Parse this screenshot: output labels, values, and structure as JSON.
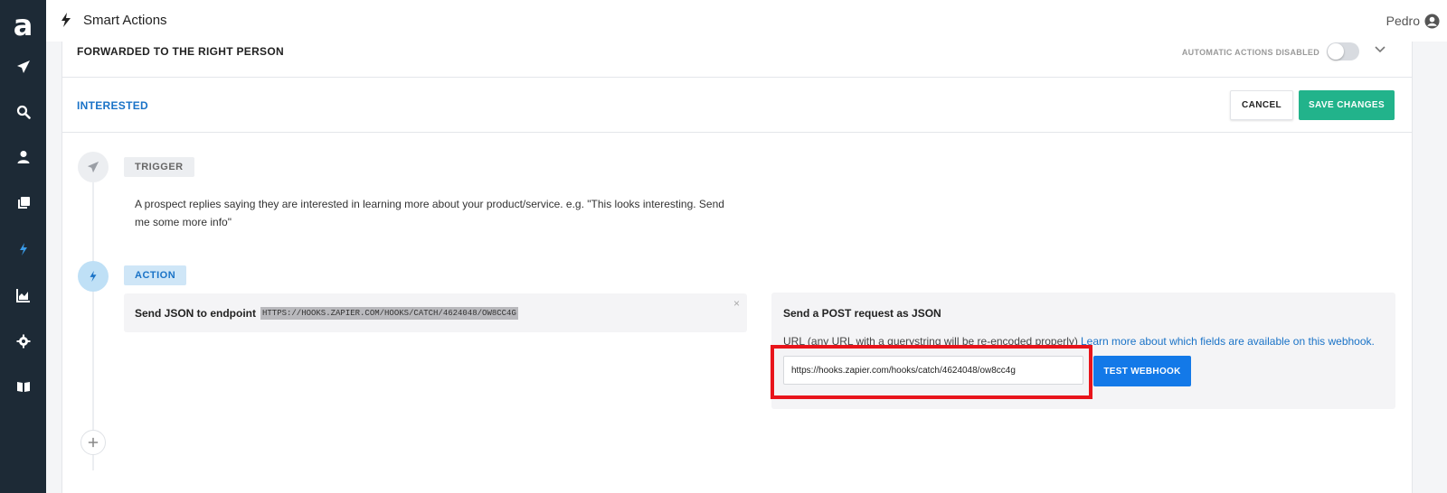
{
  "app": {
    "logo_letter": "a",
    "title": "Smart Actions",
    "user_name": "Pedro"
  },
  "sidebar": {
    "items": [
      {
        "icon": "paper-plane-icon"
      },
      {
        "icon": "search-icon"
      },
      {
        "icon": "user-icon"
      },
      {
        "icon": "copy-icon"
      },
      {
        "icon": "bolt-icon",
        "active": true
      },
      {
        "icon": "chart-icon"
      },
      {
        "icon": "gear-icon"
      },
      {
        "icon": "book-icon"
      }
    ]
  },
  "forwarded": {
    "title": "FORWARDED TO THE RIGHT PERSON",
    "auto_actions_label": "AUTOMATIC ACTIONS DISABLED"
  },
  "interested": {
    "title": "INTERESTED",
    "cancel_label": "CANCEL",
    "save_label": "SAVE CHANGES"
  },
  "trigger": {
    "tag": "TRIGGER",
    "description": "A prospect replies saying they are interested in learning more about your product/service. e.g. \"This looks interesting. Send me some more info\""
  },
  "action": {
    "tag": "ACTION",
    "card_label": "Send JSON to endpoint",
    "card_url": "HTTPS://HOOKS.ZAPIER.COM/HOOKS/CATCH/4624048/OW8CC4G",
    "close_glyph": "×"
  },
  "post": {
    "title": "Send a POST request as JSON",
    "url_label": "URL (any URL with a querystring will be re-encoded properly)",
    "learn_link": "Learn more about which fields are available on this webhook.",
    "url_value": "https://hooks.zapier.com/hooks/catch/4624048/ow8cc4g",
    "test_label": "TEST WEBHOOK"
  },
  "colors": {
    "sidebar_bg": "#1d2a36",
    "accent_blue": "#1a73c7",
    "save_green": "#22b38b",
    "test_blue": "#1379e8",
    "highlight_red": "#e8141b"
  }
}
